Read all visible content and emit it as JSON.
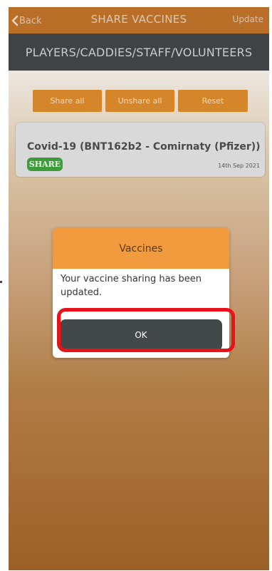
{
  "header": {
    "back_label": "Back",
    "title": "SHARE VACCINES",
    "update_label": "Update"
  },
  "category_bar": {
    "label": "PLAYERS/CADDIES/STAFF/VOLUNTEERS"
  },
  "actions": {
    "share_all": "Share all",
    "unshare_all": "Unshare all",
    "reset": "Reset"
  },
  "vaccine": {
    "name": "Covid-19 (BNT162b2 - Comirnaty (Pfizer))",
    "status": "SHARE",
    "date": "14th Sep 2021"
  },
  "modal": {
    "title": "Vaccines",
    "message": "Your vaccine sharing has been updated.",
    "ok_label": "OK"
  },
  "colors": {
    "header": "#b96f27",
    "category_bar": "#3f4346",
    "action_button": "#d6862a",
    "share_badge": "#3e9c3c",
    "modal_header": "#f19a3e",
    "ok_button": "#43484b",
    "highlight": "#e8131a"
  },
  "icons": {
    "back": "chevron-left-icon"
  }
}
